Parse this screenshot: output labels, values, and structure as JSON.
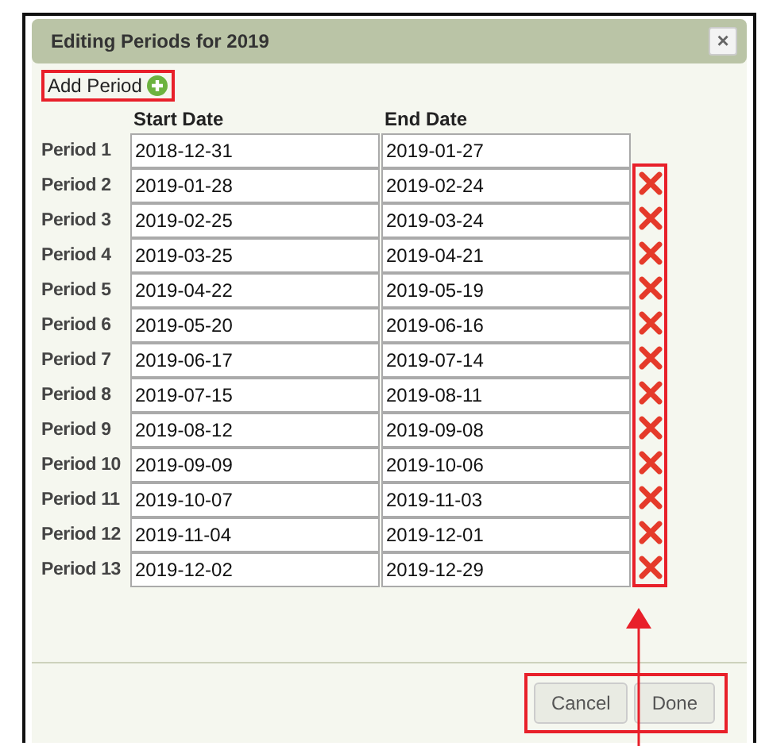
{
  "window": {
    "title": "Editing Periods for 2019",
    "close": "×"
  },
  "add_period": {
    "label": "Add Period"
  },
  "columns": [
    "Start Date",
    "End Date"
  ],
  "periods": [
    {
      "label": "Period 1",
      "start": "2018-12-31",
      "end": "2019-01-27",
      "deletable": false
    },
    {
      "label": "Period 2",
      "start": "2019-01-28",
      "end": "2019-02-24",
      "deletable": true
    },
    {
      "label": "Period 3",
      "start": "2019-02-25",
      "end": "2019-03-24",
      "deletable": true
    },
    {
      "label": "Period 4",
      "start": "2019-03-25",
      "end": "2019-04-21",
      "deletable": true
    },
    {
      "label": "Period 5",
      "start": "2019-04-22",
      "end": "2019-05-19",
      "deletable": true
    },
    {
      "label": "Period 6",
      "start": "2019-05-20",
      "end": "2019-06-16",
      "deletable": true
    },
    {
      "label": "Period 7",
      "start": "2019-06-17",
      "end": "2019-07-14",
      "deletable": true
    },
    {
      "label": "Period 8",
      "start": "2019-07-15",
      "end": "2019-08-11",
      "deletable": true
    },
    {
      "label": "Period 9",
      "start": "2019-08-12",
      "end": "2019-09-08",
      "deletable": true
    },
    {
      "label": "Period 10",
      "start": "2019-09-09",
      "end": "2019-10-06",
      "deletable": true
    },
    {
      "label": "Period 11",
      "start": "2019-10-07",
      "end": "2019-11-03",
      "deletable": true
    },
    {
      "label": "Period 12",
      "start": "2019-11-04",
      "end": "2019-12-01",
      "deletable": true
    },
    {
      "label": "Period 13",
      "start": "2019-12-02",
      "end": "2019-12-29",
      "deletable": true
    }
  ],
  "buttons": [
    "Cancel",
    "Done"
  ]
}
